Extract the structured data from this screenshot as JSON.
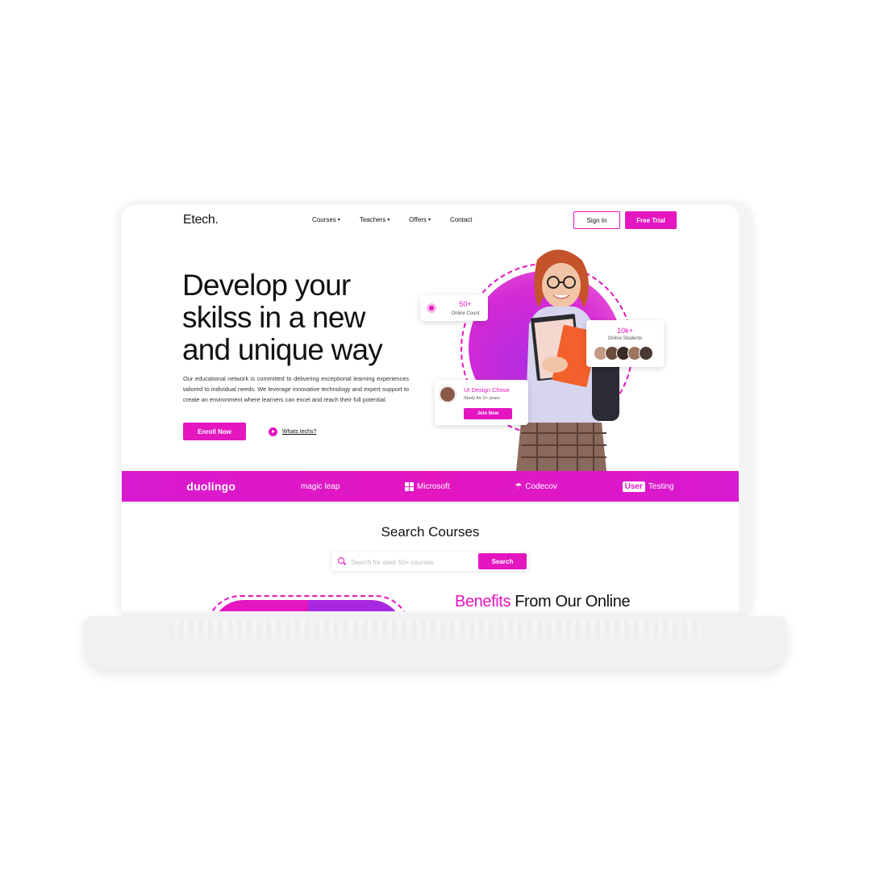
{
  "logo": "Etech.",
  "nav": {
    "items": [
      {
        "label": "Courses",
        "dropdown": true
      },
      {
        "label": "Teachers",
        "dropdown": true
      },
      {
        "label": "Offers",
        "dropdown": true
      },
      {
        "label": "Contact",
        "dropdown": false
      }
    ],
    "signin": "Sign In",
    "trial": "Free Trial"
  },
  "hero": {
    "title_line1": "Develop your",
    "title_line2": "skilss in a new",
    "title_line3": "and unique way",
    "description": "Our educational network is committed to delivering exceptional learning experiences tailored to individual needs. We leverage innovative technology and expert support to create an environment where learners can excel and reach their full potential.",
    "enroll": "Enroll Now",
    "whats": "Whats techs?"
  },
  "cards": {
    "online_count_num": "50+",
    "online_count_label": "Online Count",
    "students_num": "10k+",
    "students_label": "Online Students",
    "course_title": "UI Design Chose",
    "course_sub": "Study for 3+ years",
    "join": "Join Now"
  },
  "brands": {
    "duolingo": "duolingo",
    "magicleap": "magic leap",
    "microsoft": "Microsoft",
    "codecov": "Codecov",
    "user": "User",
    "testing": "Testing"
  },
  "search": {
    "title": "Search Courses",
    "placeholder": "Search for ower 50+ courses",
    "button": "Search"
  },
  "benefits": {
    "accent": "Benefits",
    "rest": " From Our Online"
  },
  "colors": {
    "accent": "#e316c0",
    "purple": "#a827e0"
  }
}
